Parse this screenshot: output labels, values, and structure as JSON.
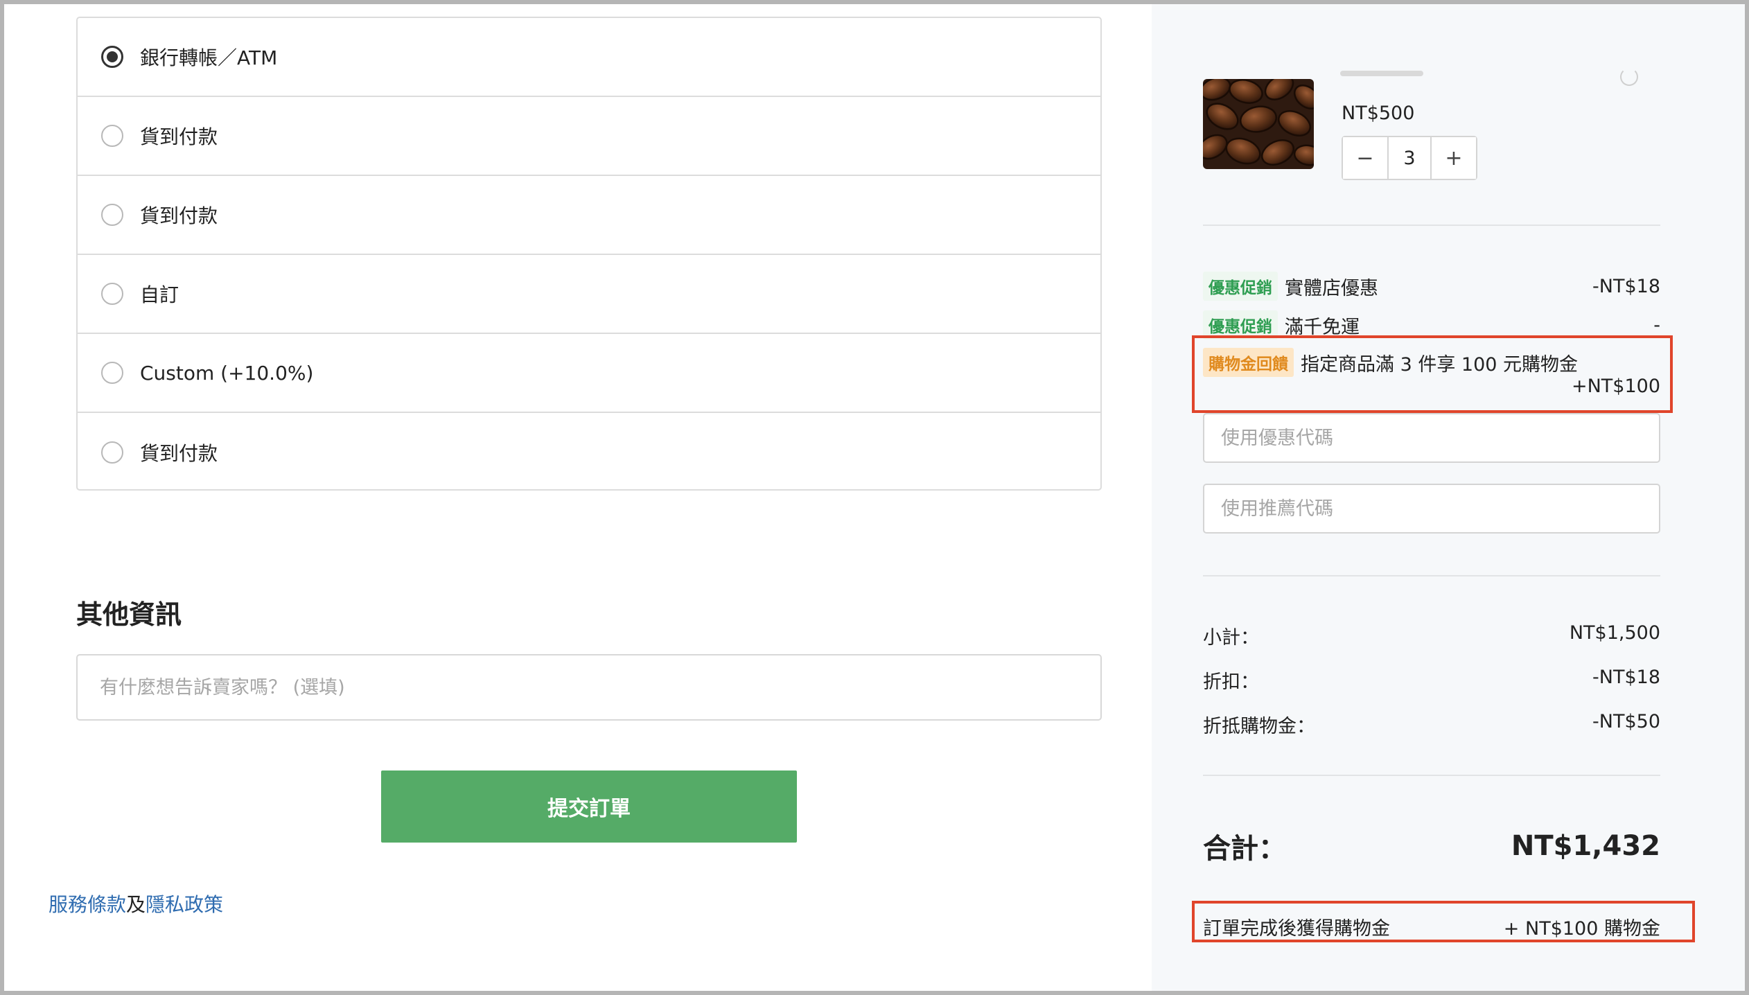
{
  "payment": {
    "options": [
      {
        "label": "銀行轉帳／ATM",
        "selected": true
      },
      {
        "label": "貨到付款",
        "selected": false
      },
      {
        "label": "貨到付款",
        "selected": false
      },
      {
        "label": "自訂",
        "selected": false
      },
      {
        "label": "Custom (+10.0%)",
        "selected": false
      },
      {
        "label": "貨到付款",
        "selected": false
      }
    ]
  },
  "other_info": {
    "title": "其他資訊",
    "note_placeholder": "有什麼想告訴賣家嗎？ (選填)"
  },
  "submit": {
    "label": "提交訂單"
  },
  "legal": {
    "terms": "服務條款",
    "and": "及",
    "privacy": "隱私政策"
  },
  "cart": {
    "item": {
      "price": "NT$500",
      "quantity": "3",
      "minus": "−",
      "plus": "+"
    },
    "promotions": [
      {
        "tag": "優惠促銷",
        "name": "實體店優惠",
        "value": "-NT$18"
      },
      {
        "tag": "優惠促銷",
        "name": "滿千免運",
        "value": "-"
      }
    ],
    "credit_promo": {
      "tag": "購物金回饋",
      "name": "指定商品滿 3 件享 100 元購物金",
      "value": "+NT$100"
    },
    "coupon_placeholder": "使用優惠代碼",
    "referral_placeholder": "使用推薦代碼",
    "summary": {
      "subtotal_label": "小計：",
      "subtotal": "NT$1,500",
      "discount_label": "折扣：",
      "discount": "-NT$18",
      "credit_label": "折抵購物金：",
      "credit": "-NT$50"
    },
    "total_label": "合計：",
    "total": "NT$1,432",
    "reward_label": "訂單完成後獲得購物金",
    "reward_value": "+ NT$100 購物金"
  },
  "colors": {
    "accent_green": "#55ab67",
    "link_blue": "#2f6cb0",
    "highlight_red": "#e0452b",
    "promo_green": "#2f9e52",
    "promo_orange": "#e08a1e"
  }
}
